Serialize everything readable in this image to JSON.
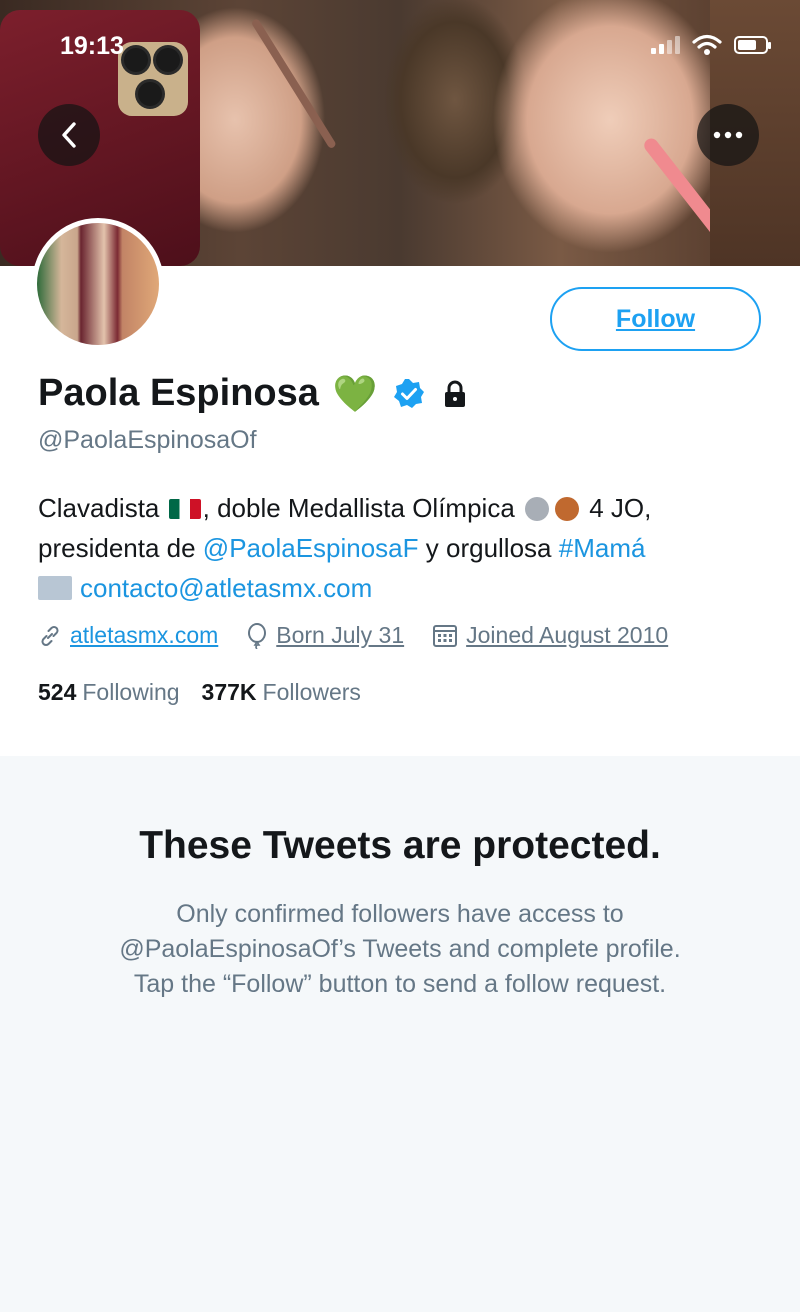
{
  "status_bar": {
    "time": "19:13"
  },
  "profile": {
    "follow_label": "Follow",
    "name": "Paola Espinosa",
    "name_emoji": "💚",
    "handle": "@PaolaEspinosaOf",
    "bio": {
      "part1": "Clavadista",
      "part2": ", doble Medallista Olímpica",
      "part3": "4 JO,",
      "part4": "presidenta de",
      "mention": "@PaolaEspinosaF",
      "part5": "y orgullosa",
      "hashtag": "#Mamá",
      "email": "contacto@atletasmx.com"
    },
    "website": "atletasmx.com",
    "birthday": "Born July 31",
    "joined": "Joined August 2010",
    "following_count": "524",
    "following_label": "Following",
    "followers_count": "377K",
    "followers_label": "Followers"
  },
  "protected": {
    "title": "These Tweets are protected.",
    "line1": "Only confirmed followers have access to",
    "line2": "@PaolaEspinosaOf’s Tweets and complete profile.",
    "line3": "Tap the “Follow” button to send a follow request."
  },
  "icons": [
    "back-arrow-icon",
    "more-icon",
    "verified-badge-icon",
    "lock-icon",
    "link-icon",
    "birthday-balloon-icon",
    "calendar-icon",
    "envelope-icon",
    "wifi-icon",
    "battery-icon",
    "signal-icon"
  ],
  "colors": {
    "accent": "#1da1f2",
    "link": "#1b95e0",
    "muted": "#657786",
    "text": "#14171a",
    "background": "#f5f8fa"
  }
}
